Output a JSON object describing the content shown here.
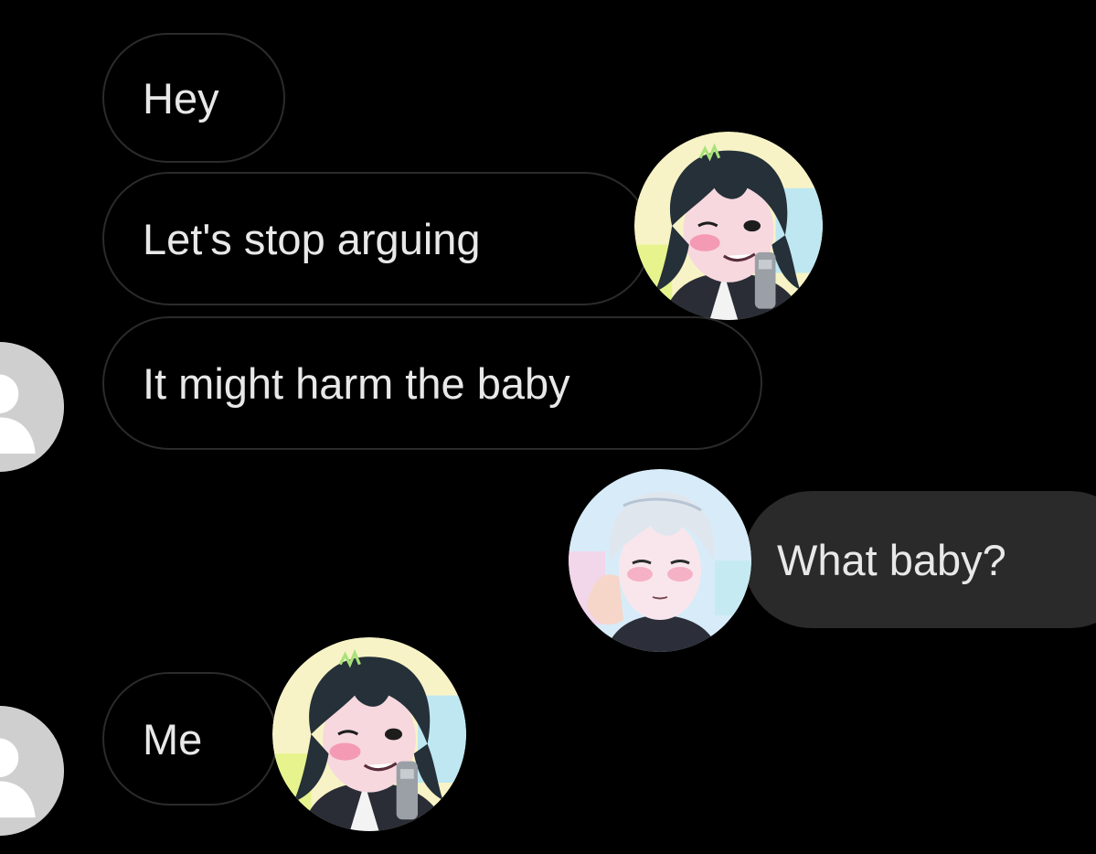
{
  "conversation": {
    "messages": [
      {
        "side": "incoming",
        "text": "Hey"
      },
      {
        "side": "incoming",
        "text": "Let's stop arguing"
      },
      {
        "side": "incoming",
        "text": "It might harm the baby"
      },
      {
        "side": "outgoing",
        "text": "What baby?"
      },
      {
        "side": "incoming",
        "text": "Me"
      }
    ]
  },
  "icons": {
    "default_avatar": "default-user-avatar-icon",
    "sticker_dark_hair": "dark-haired-character-sticker",
    "sticker_white_hair": "white-haired-character-sticker"
  },
  "colors": {
    "background": "#000000",
    "incoming_border": "#2b2b2b",
    "outgoing_fill": "#2a2a2a",
    "text": "#e8e8e8",
    "default_avatar": "#cfcfcf"
  }
}
